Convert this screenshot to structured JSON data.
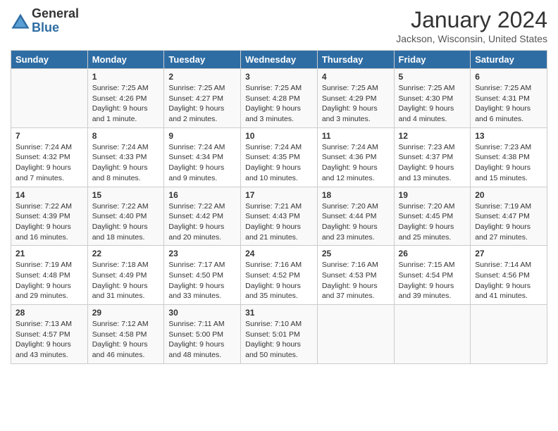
{
  "logo": {
    "general": "General",
    "blue": "Blue"
  },
  "title": "January 2024",
  "location": "Jackson, Wisconsin, United States",
  "days_of_week": [
    "Sunday",
    "Monday",
    "Tuesday",
    "Wednesday",
    "Thursday",
    "Friday",
    "Saturday"
  ],
  "weeks": [
    [
      {
        "day": "",
        "sunrise": "",
        "sunset": "",
        "daylight": ""
      },
      {
        "day": "1",
        "sunrise": "Sunrise: 7:25 AM",
        "sunset": "Sunset: 4:26 PM",
        "daylight": "Daylight: 9 hours and 1 minute."
      },
      {
        "day": "2",
        "sunrise": "Sunrise: 7:25 AM",
        "sunset": "Sunset: 4:27 PM",
        "daylight": "Daylight: 9 hours and 2 minutes."
      },
      {
        "day": "3",
        "sunrise": "Sunrise: 7:25 AM",
        "sunset": "Sunset: 4:28 PM",
        "daylight": "Daylight: 9 hours and 3 minutes."
      },
      {
        "day": "4",
        "sunrise": "Sunrise: 7:25 AM",
        "sunset": "Sunset: 4:29 PM",
        "daylight": "Daylight: 9 hours and 3 minutes."
      },
      {
        "day": "5",
        "sunrise": "Sunrise: 7:25 AM",
        "sunset": "Sunset: 4:30 PM",
        "daylight": "Daylight: 9 hours and 4 minutes."
      },
      {
        "day": "6",
        "sunrise": "Sunrise: 7:25 AM",
        "sunset": "Sunset: 4:31 PM",
        "daylight": "Daylight: 9 hours and 6 minutes."
      }
    ],
    [
      {
        "day": "7",
        "sunrise": "Sunrise: 7:24 AM",
        "sunset": "Sunset: 4:32 PM",
        "daylight": "Daylight: 9 hours and 7 minutes."
      },
      {
        "day": "8",
        "sunrise": "Sunrise: 7:24 AM",
        "sunset": "Sunset: 4:33 PM",
        "daylight": "Daylight: 9 hours and 8 minutes."
      },
      {
        "day": "9",
        "sunrise": "Sunrise: 7:24 AM",
        "sunset": "Sunset: 4:34 PM",
        "daylight": "Daylight: 9 hours and 9 minutes."
      },
      {
        "day": "10",
        "sunrise": "Sunrise: 7:24 AM",
        "sunset": "Sunset: 4:35 PM",
        "daylight": "Daylight: 9 hours and 10 minutes."
      },
      {
        "day": "11",
        "sunrise": "Sunrise: 7:24 AM",
        "sunset": "Sunset: 4:36 PM",
        "daylight": "Daylight: 9 hours and 12 minutes."
      },
      {
        "day": "12",
        "sunrise": "Sunrise: 7:23 AM",
        "sunset": "Sunset: 4:37 PM",
        "daylight": "Daylight: 9 hours and 13 minutes."
      },
      {
        "day": "13",
        "sunrise": "Sunrise: 7:23 AM",
        "sunset": "Sunset: 4:38 PM",
        "daylight": "Daylight: 9 hours and 15 minutes."
      }
    ],
    [
      {
        "day": "14",
        "sunrise": "Sunrise: 7:22 AM",
        "sunset": "Sunset: 4:39 PM",
        "daylight": "Daylight: 9 hours and 16 minutes."
      },
      {
        "day": "15",
        "sunrise": "Sunrise: 7:22 AM",
        "sunset": "Sunset: 4:40 PM",
        "daylight": "Daylight: 9 hours and 18 minutes."
      },
      {
        "day": "16",
        "sunrise": "Sunrise: 7:22 AM",
        "sunset": "Sunset: 4:42 PM",
        "daylight": "Daylight: 9 hours and 20 minutes."
      },
      {
        "day": "17",
        "sunrise": "Sunrise: 7:21 AM",
        "sunset": "Sunset: 4:43 PM",
        "daylight": "Daylight: 9 hours and 21 minutes."
      },
      {
        "day": "18",
        "sunrise": "Sunrise: 7:20 AM",
        "sunset": "Sunset: 4:44 PM",
        "daylight": "Daylight: 9 hours and 23 minutes."
      },
      {
        "day": "19",
        "sunrise": "Sunrise: 7:20 AM",
        "sunset": "Sunset: 4:45 PM",
        "daylight": "Daylight: 9 hours and 25 minutes."
      },
      {
        "day": "20",
        "sunrise": "Sunrise: 7:19 AM",
        "sunset": "Sunset: 4:47 PM",
        "daylight": "Daylight: 9 hours and 27 minutes."
      }
    ],
    [
      {
        "day": "21",
        "sunrise": "Sunrise: 7:19 AM",
        "sunset": "Sunset: 4:48 PM",
        "daylight": "Daylight: 9 hours and 29 minutes."
      },
      {
        "day": "22",
        "sunrise": "Sunrise: 7:18 AM",
        "sunset": "Sunset: 4:49 PM",
        "daylight": "Daylight: 9 hours and 31 minutes."
      },
      {
        "day": "23",
        "sunrise": "Sunrise: 7:17 AM",
        "sunset": "Sunset: 4:50 PM",
        "daylight": "Daylight: 9 hours and 33 minutes."
      },
      {
        "day": "24",
        "sunrise": "Sunrise: 7:16 AM",
        "sunset": "Sunset: 4:52 PM",
        "daylight": "Daylight: 9 hours and 35 minutes."
      },
      {
        "day": "25",
        "sunrise": "Sunrise: 7:16 AM",
        "sunset": "Sunset: 4:53 PM",
        "daylight": "Daylight: 9 hours and 37 minutes."
      },
      {
        "day": "26",
        "sunrise": "Sunrise: 7:15 AM",
        "sunset": "Sunset: 4:54 PM",
        "daylight": "Daylight: 9 hours and 39 minutes."
      },
      {
        "day": "27",
        "sunrise": "Sunrise: 7:14 AM",
        "sunset": "Sunset: 4:56 PM",
        "daylight": "Daylight: 9 hours and 41 minutes."
      }
    ],
    [
      {
        "day": "28",
        "sunrise": "Sunrise: 7:13 AM",
        "sunset": "Sunset: 4:57 PM",
        "daylight": "Daylight: 9 hours and 43 minutes."
      },
      {
        "day": "29",
        "sunrise": "Sunrise: 7:12 AM",
        "sunset": "Sunset: 4:58 PM",
        "daylight": "Daylight: 9 hours and 46 minutes."
      },
      {
        "day": "30",
        "sunrise": "Sunrise: 7:11 AM",
        "sunset": "Sunset: 5:00 PM",
        "daylight": "Daylight: 9 hours and 48 minutes."
      },
      {
        "day": "31",
        "sunrise": "Sunrise: 7:10 AM",
        "sunset": "Sunset: 5:01 PM",
        "daylight": "Daylight: 9 hours and 50 minutes."
      },
      {
        "day": "",
        "sunrise": "",
        "sunset": "",
        "daylight": ""
      },
      {
        "day": "",
        "sunrise": "",
        "sunset": "",
        "daylight": ""
      },
      {
        "day": "",
        "sunrise": "",
        "sunset": "",
        "daylight": ""
      }
    ]
  ]
}
